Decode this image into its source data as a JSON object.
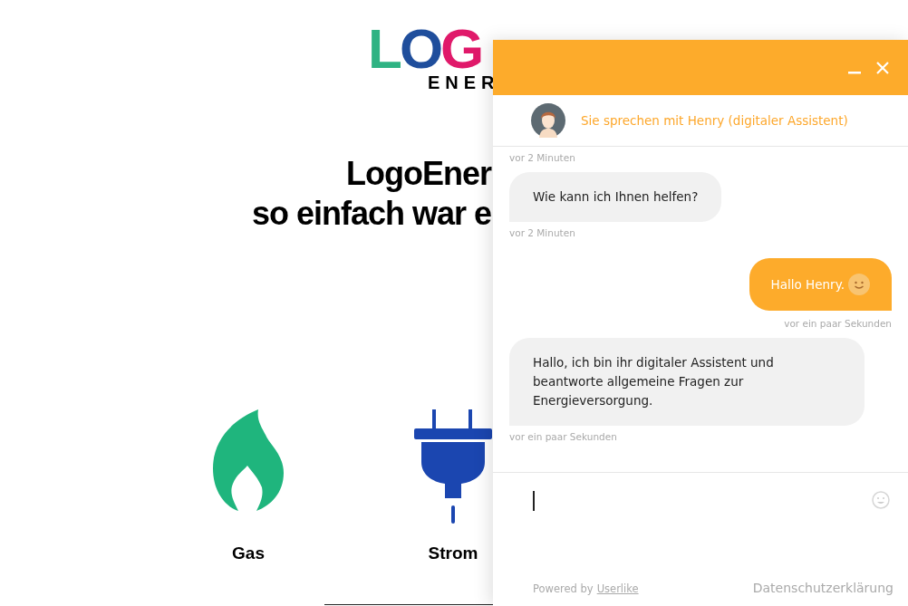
{
  "logo": {
    "letters": [
      {
        "char": "L",
        "color": "#2fb383"
      },
      {
        "char": "O",
        "color": "#1f4e9c"
      },
      {
        "char": "G",
        "color": "#e0196a"
      }
    ],
    "subtitle": "ENER"
  },
  "headline": [
    "LogoEner",
    "so einfach war e"
  ],
  "products": [
    {
      "kind": "gas",
      "label": "Gas"
    },
    {
      "kind": "power",
      "label": "Strom"
    }
  ],
  "chat": {
    "agent": "Sie sprechen mit Henry (digitaler Assistent)",
    "messages": [
      {
        "kind": "stamp",
        "text": "vor 2 Minuten"
      },
      {
        "kind": "agent",
        "text": "Wie kann ich Ihnen helfen?"
      },
      {
        "kind": "stamp",
        "text": "vor 2 Minuten"
      },
      {
        "kind": "user",
        "text": "Hallo Henry.",
        "emoji": true
      },
      {
        "kind": "stamp-right",
        "text": "vor ein paar Sekunden"
      },
      {
        "kind": "agent",
        "text": "Hallo, ich bin ihr digitaler Assistent und beantworte allgemeine Fragen zur Energieversorgung."
      },
      {
        "kind": "stamp",
        "text": "vor ein paar Sekunden"
      }
    ],
    "powered_by": "Powered by",
    "powered_link": "Userlike",
    "privacy": "Datenschutzerklärung"
  }
}
